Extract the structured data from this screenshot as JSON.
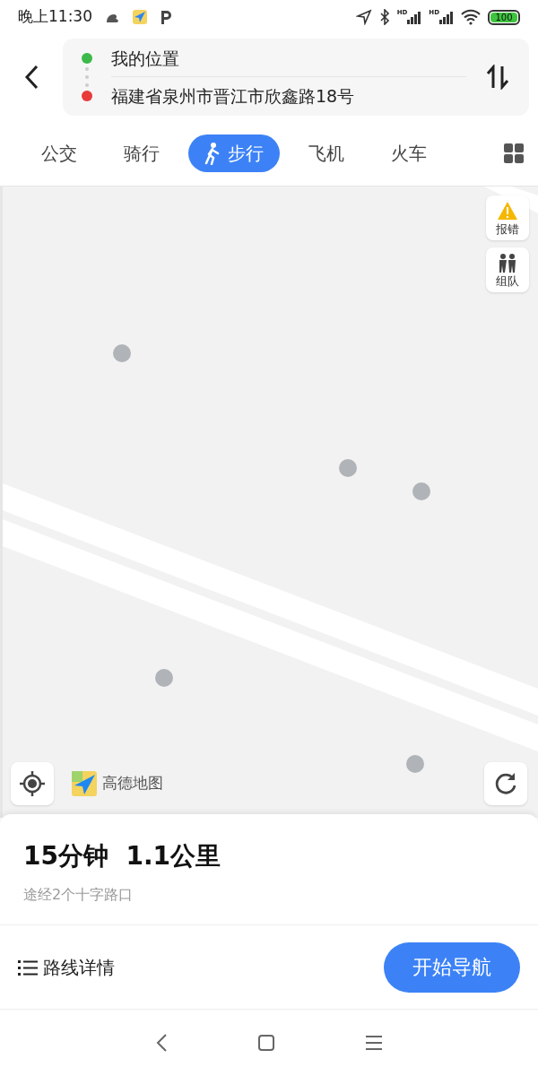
{
  "status_bar": {
    "time": "晚上11:30",
    "hd_labels": [
      "HD",
      "HD"
    ],
    "battery": "100"
  },
  "route": {
    "origin": "我的位置",
    "destination": "福建省泉州市晋江市欣鑫路18号"
  },
  "tabs": [
    {
      "label": "公交",
      "selected": false
    },
    {
      "label": "骑行",
      "selected": false
    },
    {
      "label": "步行",
      "selected": true
    },
    {
      "label": "飞机",
      "selected": false
    },
    {
      "label": "火车",
      "selected": false
    }
  ],
  "map": {
    "kind": "picture",
    "side_buttons": [
      "报错",
      "组队"
    ],
    "logo": "高德地图"
  },
  "summary": {
    "title": "15分钟  1.1公里",
    "subtitle": "途经2个十字路口"
  },
  "actions": {
    "details": "路线详情",
    "start": "开始导航"
  }
}
